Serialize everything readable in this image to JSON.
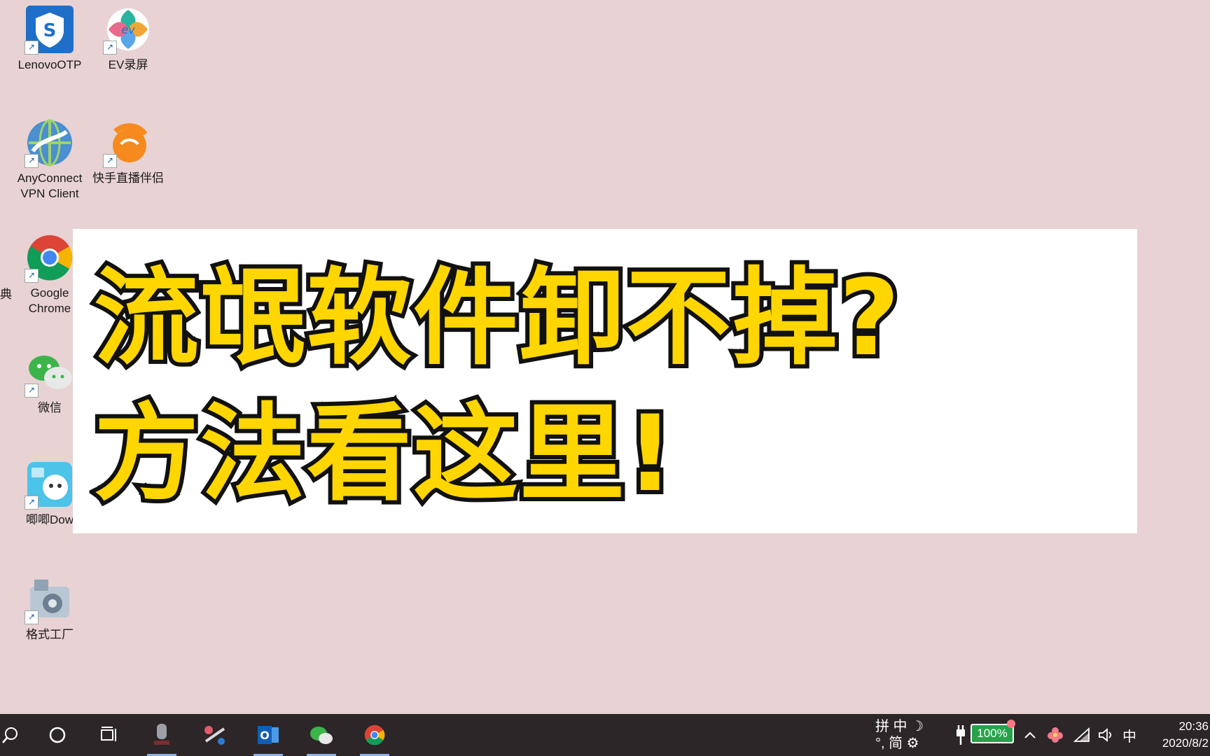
{
  "desktop": {
    "icons": [
      {
        "label": "LenovoOTP"
      },
      {
        "label": "EV录屏"
      },
      {
        "label": "AnyConnect\nVPN Client"
      },
      {
        "label": "快手直播伴侣"
      },
      {
        "label": "Google\nChrome"
      },
      {
        "label": "微信"
      },
      {
        "label": "唧唧Dow"
      },
      {
        "label": "格式工厂"
      }
    ],
    "clipped_left_label": "典"
  },
  "banner": {
    "line1": "流氓软件卸不掉?",
    "line2": "方法看这里!"
  },
  "taskbar": {
    "ime_top": "拼 中 ☽",
    "ime_bottom": "°, 简 ⚙",
    "battery_text": "100%",
    "tray_lang": "中",
    "time": "20:36",
    "date": "2020/8/2"
  },
  "colors": {
    "desktop_bg": "#e8d2d3",
    "banner_text": "#ffd600",
    "taskbar_bg": "#2c2628",
    "battery_green": "#26a34a"
  }
}
